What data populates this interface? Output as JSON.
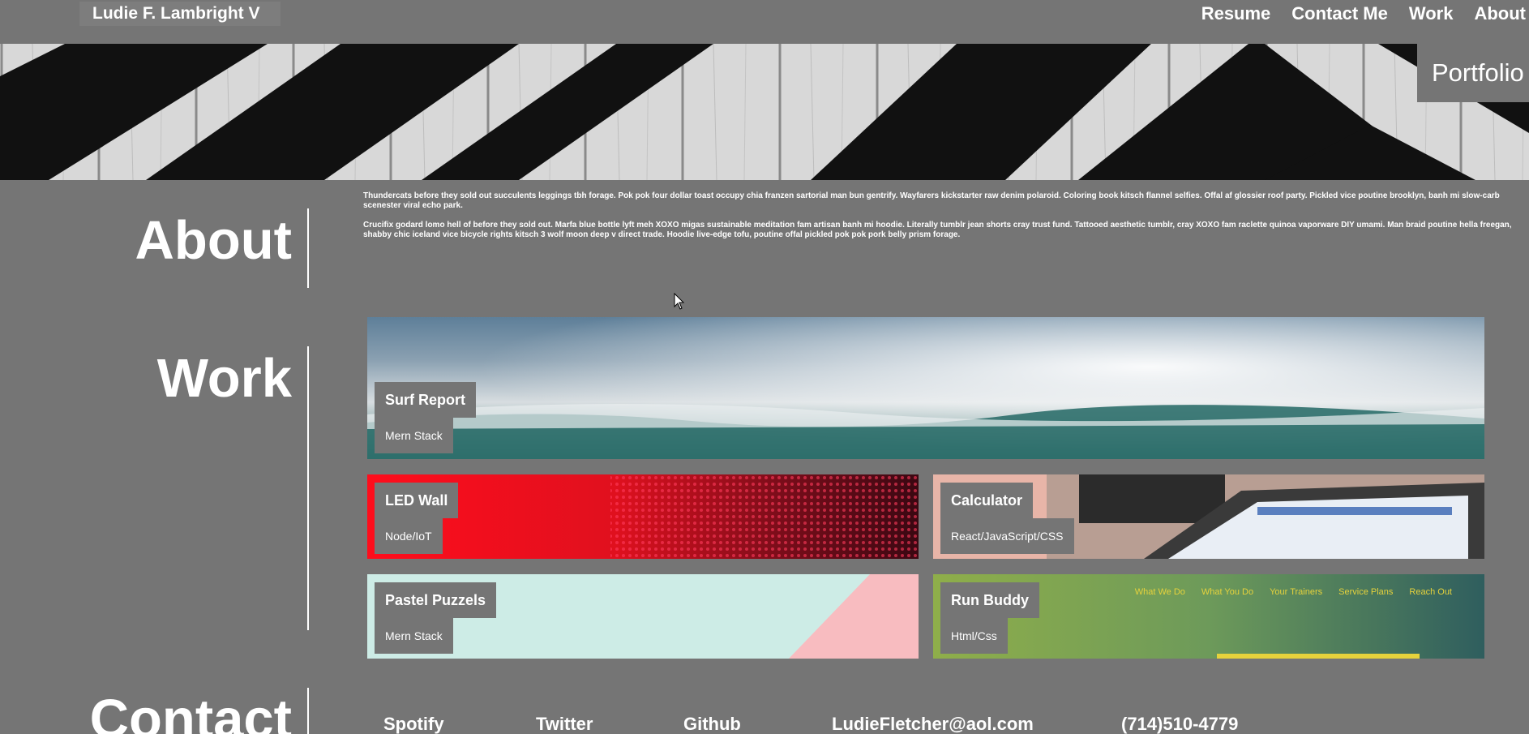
{
  "nav": {
    "brand": "Ludie F. Lambright V",
    "links": [
      "Resume",
      "Contact Me",
      "Work",
      "About"
    ]
  },
  "hero": {
    "badge": "Portfolio"
  },
  "about": {
    "title": "About",
    "paragraphs": [
      "Thundercats before they sold out succulents leggings tbh forage. Pok pok four dollar toast occupy chia franzen sartorial man bun gentrify. Wayfarers kickstarter raw denim polaroid. Coloring book kitsch flannel selfies. Offal af glossier roof party. Pickled vice poutine brooklyn, banh mi slow-carb scenester viral echo park.",
      "Crucifix godard lomo hell of before they sold out. Marfa blue bottle lyft meh XOXO migas sustainable meditation fam artisan banh mi hoodie. Literally tumblr jean shorts cray trust fund. Tattooed aesthetic tumblr, cray XOXO fam raclette quinoa vaporware DIY umami. Man braid poutine hella freegan, shabby chic iceland vice bicycle rights kitsch 3 wolf moon deep v direct trade. Hoodie live-edge tofu, poutine offal pickled pok pok pork belly prism forage."
    ]
  },
  "work": {
    "title": "Work",
    "projects": [
      {
        "title": "Surf Report",
        "stack": "Mern Stack"
      },
      {
        "title": "LED Wall",
        "stack": "Node/IoT"
      },
      {
        "title": "Calculator",
        "stack": "React/JavaScript/CSS"
      },
      {
        "title": "Pastel Puzzels",
        "stack": "Mern Stack"
      },
      {
        "title": "Run Buddy",
        "stack": "Html/Css",
        "preview_nav": [
          "What We Do",
          "What You Do",
          "Your Trainers",
          "Service Plans",
          "Reach Out"
        ]
      }
    ]
  },
  "contact": {
    "title": "Contact",
    "links": [
      "Spotify",
      "Twitter",
      "Github",
      "LudieFletcher@aol.com",
      "(714)510-4779"
    ]
  },
  "colors": {
    "background": "#757575",
    "text": "#ffffff",
    "accent_led": "#e0101e",
    "accent_run_nav": "#e6d23c"
  }
}
